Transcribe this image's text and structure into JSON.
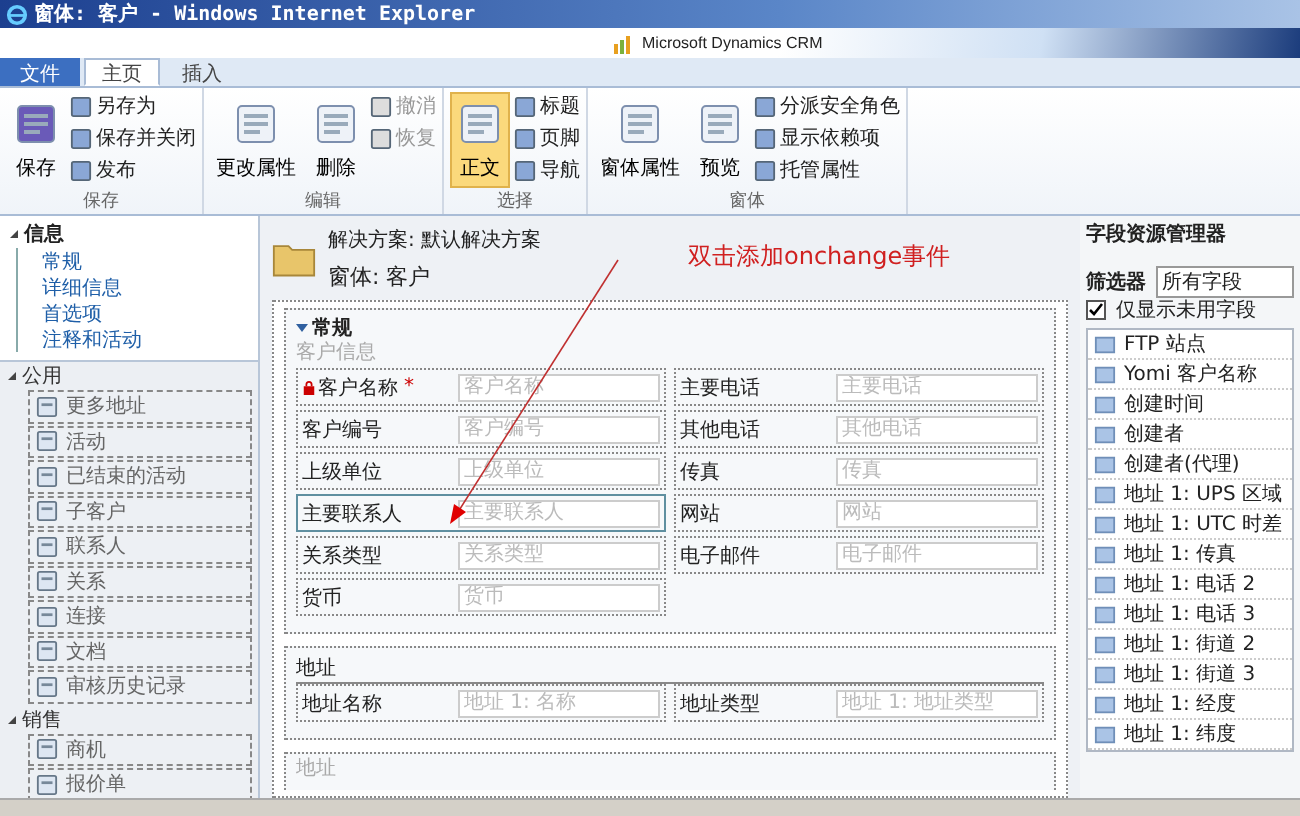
{
  "window": {
    "title": "窗体: 客户 - Windows Internet Explorer"
  },
  "brand": "Microsoft Dynamics CRM",
  "tabs": [
    {
      "label": "文件",
      "kind": "file",
      "selected": false
    },
    {
      "label": "主页",
      "kind": "tab",
      "selected": true
    },
    {
      "label": "插入",
      "kind": "tab",
      "selected": false
    }
  ],
  "ribbon": [
    {
      "group": "保存",
      "large": [
        {
          "label": "保存",
          "selected": false
        }
      ],
      "small": [
        {
          "label": "另存为",
          "disabled": false
        },
        {
          "label": "保存并关闭",
          "disabled": false
        },
        {
          "label": "发布",
          "disabled": false
        }
      ]
    },
    {
      "group": "编辑",
      "large": [
        {
          "label": "更改属性",
          "selected": false
        },
        {
          "label": "删除",
          "selected": false
        }
      ],
      "small": [
        {
          "label": "撤消",
          "disabled": true
        },
        {
          "label": "恢复",
          "disabled": true
        }
      ]
    },
    {
      "group": "选择",
      "large": [
        {
          "label": "正文",
          "selected": true
        }
      ],
      "small": [
        {
          "label": "标题",
          "disabled": false
        },
        {
          "label": "页脚",
          "disabled": false
        },
        {
          "label": "导航",
          "disabled": false
        }
      ]
    },
    {
      "group": "窗体",
      "large": [
        {
          "label": "窗体属性",
          "selected": false
        },
        {
          "label": "预览",
          "selected": false
        }
      ],
      "small": [
        {
          "label": "分派安全角色",
          "disabled": false
        },
        {
          "label": "显示依赖项",
          "disabled": false
        },
        {
          "label": "托管属性",
          "disabled": false
        }
      ]
    }
  ],
  "nav": {
    "info": {
      "label": "信息",
      "expanded": true,
      "children": [
        {
          "label": "常规"
        },
        {
          "label": "详细信息"
        },
        {
          "label": "首选项"
        },
        {
          "label": "注释和活动"
        }
      ]
    },
    "groups": [
      {
        "label": "公用",
        "expanded": true,
        "items": [
          "更多地址",
          "活动",
          "已结束的活动",
          "子客户",
          "联系人",
          "关系",
          "连接",
          "文档",
          "审核历史记录"
        ]
      },
      {
        "label": "销售",
        "expanded": true,
        "items": [
          "商机",
          "报价单"
        ]
      }
    ]
  },
  "form": {
    "solution": "解决方案: 默认解决方案",
    "form_name": "窗体: 客户",
    "annotation": "双击添加onchange事件",
    "sections": [
      {
        "title": "常规",
        "expanded": true,
        "group_label": "客户信息",
        "rows": [
          [
            {
              "label": "客户名称",
              "mark": "*",
              "placeholder": "客户名称",
              "selected": false
            },
            {
              "label": "主要电话",
              "placeholder": "主要电话",
              "selected": false
            }
          ],
          [
            {
              "label": "客户编号",
              "placeholder": "客户编号",
              "selected": false
            },
            {
              "label": "其他电话",
              "placeholder": "其他电话",
              "selected": false
            }
          ],
          [
            {
              "label": "上级单位",
              "placeholder": "上级单位",
              "selected": false
            },
            {
              "label": "传真",
              "placeholder": "传真",
              "selected": false
            }
          ],
          [
            {
              "label": "主要联系人",
              "placeholder": "主要联系人",
              "selected": true
            },
            {
              "label": "网站",
              "placeholder": "网站",
              "selected": false
            }
          ],
          [
            {
              "label": "关系类型",
              "placeholder": "关系类型",
              "selected": false
            },
            {
              "label": "电子邮件",
              "placeholder": "电子邮件",
              "selected": false
            }
          ],
          [
            {
              "label": "货币",
              "placeholder": "货币",
              "selected": false
            }
          ]
        ]
      },
      {
        "title": "地址",
        "rows": [
          [
            {
              "label": "地址名称",
              "placeholder": "地址 1: 名称",
              "selected": false
            },
            {
              "label": "地址类型",
              "placeholder": "地址 1: 地址类型",
              "selected": false
            }
          ]
        ]
      }
    ],
    "next_section": "地址"
  },
  "explorer": {
    "title": "字段资源管理器",
    "filter_label": "筛选器",
    "filter_value": "所有字段",
    "only_unused": {
      "label": "仅显示未用字段",
      "checked": true
    },
    "fields": [
      "FTP 站点",
      "Yomi 客户名称",
      "创建时间",
      "创建者",
      "创建者(代理)",
      "地址 1: UPS 区域",
      "地址 1: UTC 时差",
      "地址 1: 传真",
      "地址 1: 电话 2",
      "地址 1: 电话 3",
      "地址 1: 街道 2",
      "地址 1: 街道 3",
      "地址 1: 经度",
      "地址 1: 纬度"
    ]
  }
}
